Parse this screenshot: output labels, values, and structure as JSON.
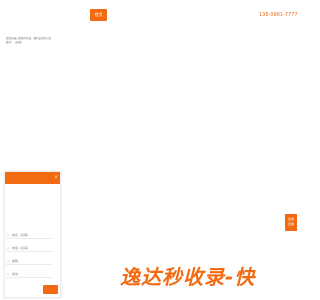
{
  "header": {
    "nav_button_label": "首页",
    "phone": "136-0961-7777"
  },
  "form": {
    "close_icon": "×",
    "description": "请您在输入框填写信息，我们会尽快与您联系！（必填）",
    "fields": [
      {
        "icon": "user-icon",
        "placeholder": "姓名（必填）"
      },
      {
        "icon": "phone-icon",
        "placeholder": "电话（必填）"
      },
      {
        "icon": "mail-icon",
        "placeholder": "邮箱"
      },
      {
        "icon": "note-icon",
        "placeholder": "留言"
      }
    ]
  },
  "float_tab": {
    "line1": "在线",
    "line2": "咨询"
  },
  "watermark": "逸达秒收录-快",
  "colors": {
    "accent": "#f26b12",
    "background": "#ffffff"
  }
}
